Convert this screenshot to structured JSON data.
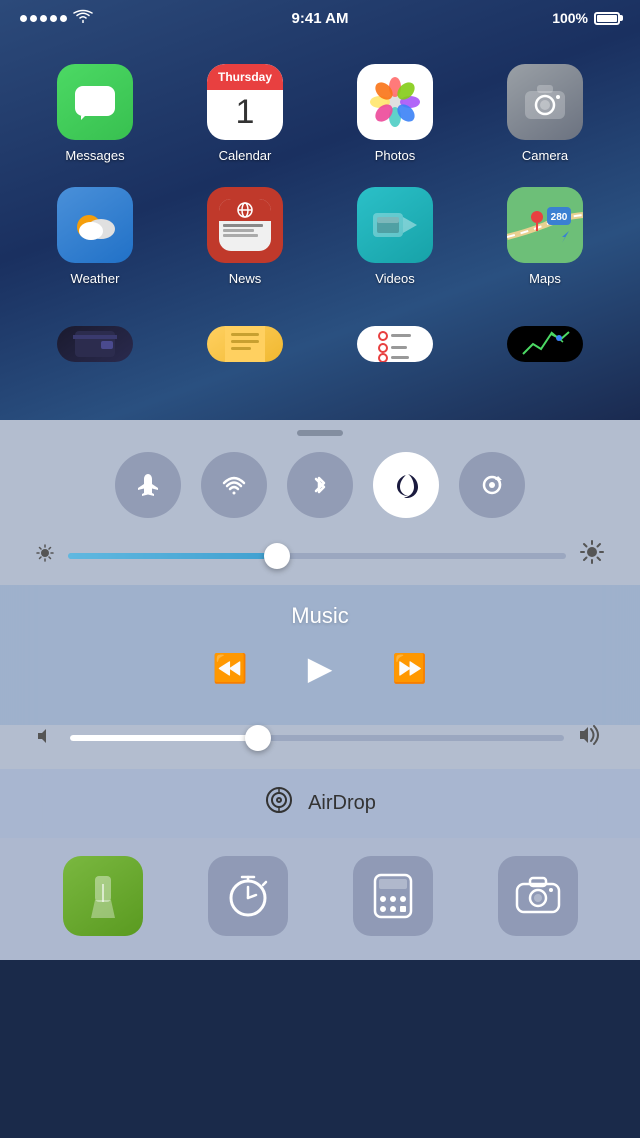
{
  "status_bar": {
    "time": "9:41 AM",
    "battery_percent": "100%",
    "signal": "●●●●●",
    "wifi": "WiFi"
  },
  "apps": {
    "row1": [
      {
        "id": "messages",
        "label": "Messages"
      },
      {
        "id": "calendar",
        "label": "Calendar",
        "day_name": "Thursday",
        "day_num": "1"
      },
      {
        "id": "photos",
        "label": "Photos"
      },
      {
        "id": "camera",
        "label": "Camera"
      }
    ],
    "row2": [
      {
        "id": "weather",
        "label": "Weather"
      },
      {
        "id": "news",
        "label": "News"
      },
      {
        "id": "videos",
        "label": "Videos"
      },
      {
        "id": "maps",
        "label": "Maps"
      }
    ]
  },
  "control_center": {
    "handle_label": "drag handle",
    "toggles": [
      {
        "id": "airplane",
        "icon": "✈",
        "active": false,
        "label": "Airplane Mode"
      },
      {
        "id": "wifi",
        "icon": "WiFi",
        "active": false,
        "label": "WiFi"
      },
      {
        "id": "bluetooth",
        "icon": "BT",
        "active": false,
        "label": "Bluetooth"
      },
      {
        "id": "do-not-disturb",
        "icon": "☽",
        "active": true,
        "label": "Do Not Disturb"
      },
      {
        "id": "rotation-lock",
        "icon": "⟳",
        "active": false,
        "label": "Rotation Lock"
      }
    ],
    "brightness": {
      "label": "Brightness",
      "value": 42
    },
    "music": {
      "title": "Music",
      "now_playing": ""
    },
    "volume": {
      "label": "Volume",
      "value": 38
    },
    "airdrop": {
      "label": "AirDrop"
    },
    "bottom_buttons": [
      {
        "id": "flashlight",
        "label": "Flashlight"
      },
      {
        "id": "timer",
        "label": "Timer"
      },
      {
        "id": "calculator",
        "label": "Calculator"
      },
      {
        "id": "camera",
        "label": "Camera"
      }
    ]
  }
}
